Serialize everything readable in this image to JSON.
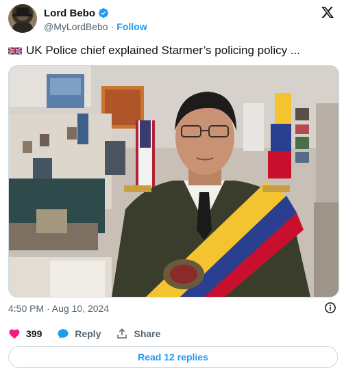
{
  "author": {
    "name": "Lord Bebo",
    "handle": "@MyLordBebo",
    "separator": "·",
    "follow_label": "Follow"
  },
  "tweet": {
    "text": "UK Police chief explained Starmer’s policing policy ..."
  },
  "meta": {
    "timestamp": "4:50 PM · Aug 10, 2024"
  },
  "actions": {
    "like_count": "399",
    "reply_label": "Reply",
    "share_label": "Share"
  },
  "replies_button": "Read 12 replies",
  "icons": {
    "verified": "verified-badge-icon",
    "x_logo": "x-logo-icon",
    "flag": "uk-flag-icon",
    "info": "info-icon",
    "like": "heart-icon",
    "reply": "speech-bubble-icon",
    "share": "share-icon"
  },
  "colors": {
    "accent": "#1d9bf0",
    "like": "#f91880",
    "muted": "#536471"
  }
}
